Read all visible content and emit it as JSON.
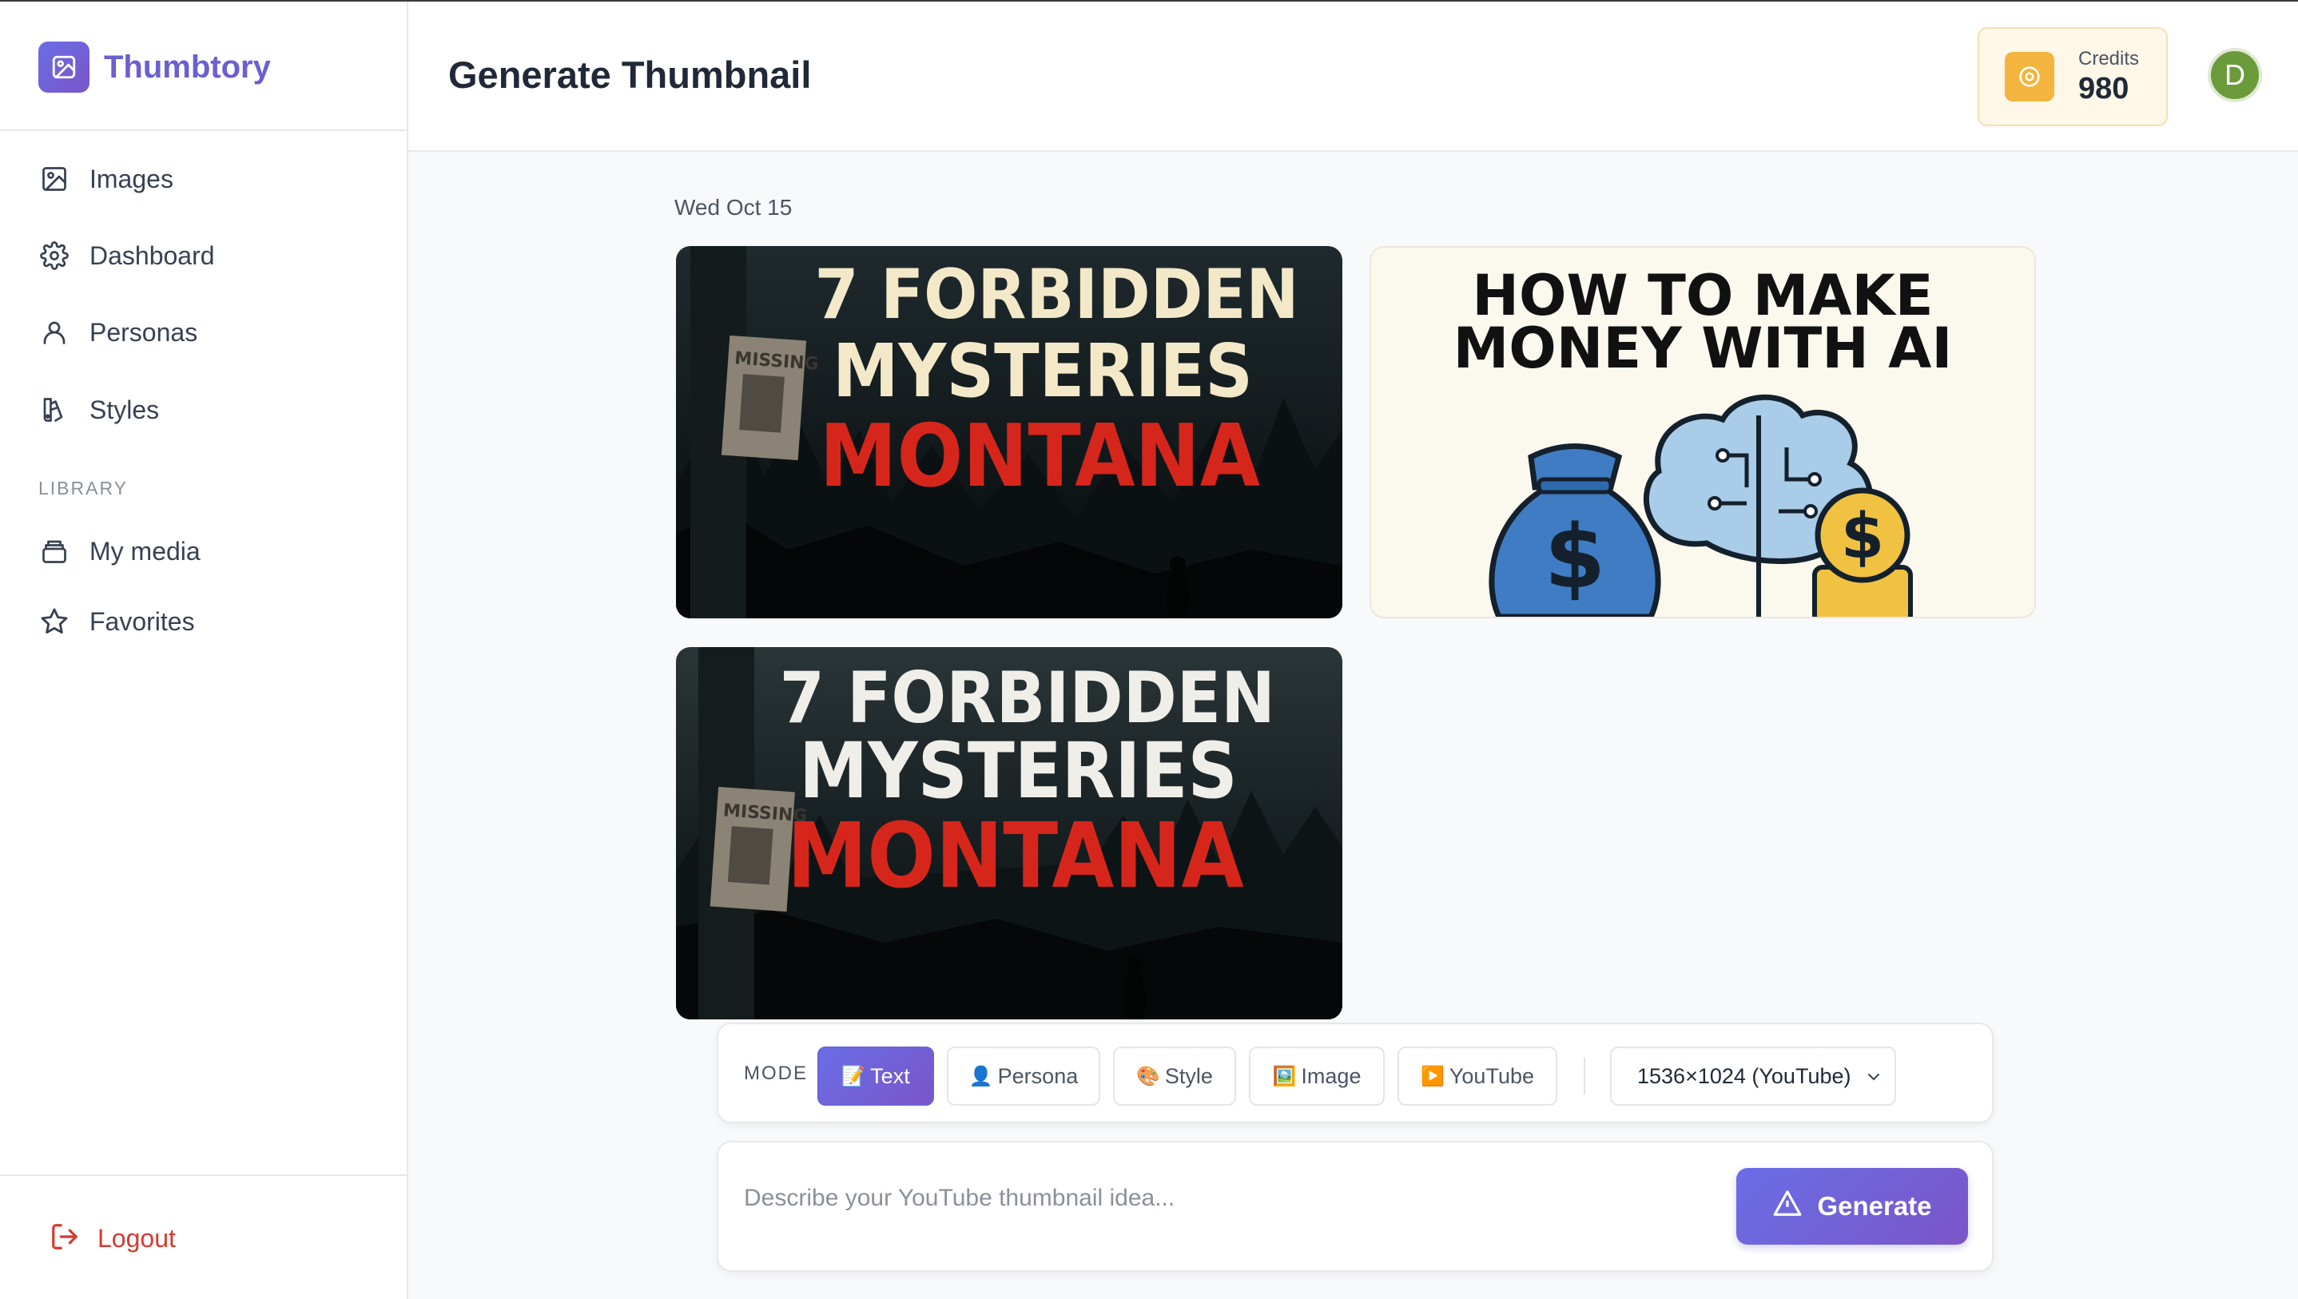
{
  "brand": {
    "name": "Thumbtory"
  },
  "sidebar": {
    "items": [
      {
        "label": "Images",
        "icon": "image-icon"
      },
      {
        "label": "Dashboard",
        "icon": "gear-icon"
      },
      {
        "label": "Personas",
        "icon": "user-icon"
      },
      {
        "label": "Styles",
        "icon": "palette-icon"
      }
    ],
    "library_heading": "LIBRARY",
    "library_items": [
      {
        "label": "My media",
        "icon": "media-stack-icon"
      },
      {
        "label": "Favorites",
        "icon": "star-icon"
      }
    ],
    "logout_label": "Logout"
  },
  "header": {
    "title": "Generate Thumbnail",
    "credits_label": "Credits",
    "credits_value": "980",
    "avatar_initial": "D"
  },
  "feed": {
    "date": "Wed Oct 15",
    "thumbnails": [
      {
        "lines": [
          "7 FORBIDDEN",
          "MYSTERIES",
          "MONTANA"
        ],
        "sign": "MISSING"
      },
      {
        "lines": [
          "HOW TO MAKE",
          "MONEY WITH AI"
        ],
        "glyph": "$"
      },
      {
        "lines": [
          "7 FORBIDDEN",
          "MYSTERIES",
          "MONTANA"
        ],
        "sign": "MISSING"
      }
    ]
  },
  "mode_bar": {
    "label": "MODE",
    "buttons": [
      {
        "emoji": "📝",
        "label": "Text",
        "active": true
      },
      {
        "emoji": "👤",
        "label": "Persona",
        "active": false
      },
      {
        "emoji": "🎨",
        "label": "Style",
        "active": false
      },
      {
        "emoji": "🖼️",
        "label": "Image",
        "active": false
      },
      {
        "emoji": "▶️",
        "label": "YouTube",
        "active": false
      }
    ],
    "size_selected": "1536×1024 (YouTube)"
  },
  "prompt": {
    "placeholder": "Describe your YouTube thumbnail idea...",
    "generate_label": "Generate"
  },
  "colors": {
    "accent": "#6b5fd1",
    "logout": "#d63a2f",
    "credits_bg": "#fff7e8",
    "avatar": "#6b9a3b",
    "thumb_red": "#d6261c"
  }
}
